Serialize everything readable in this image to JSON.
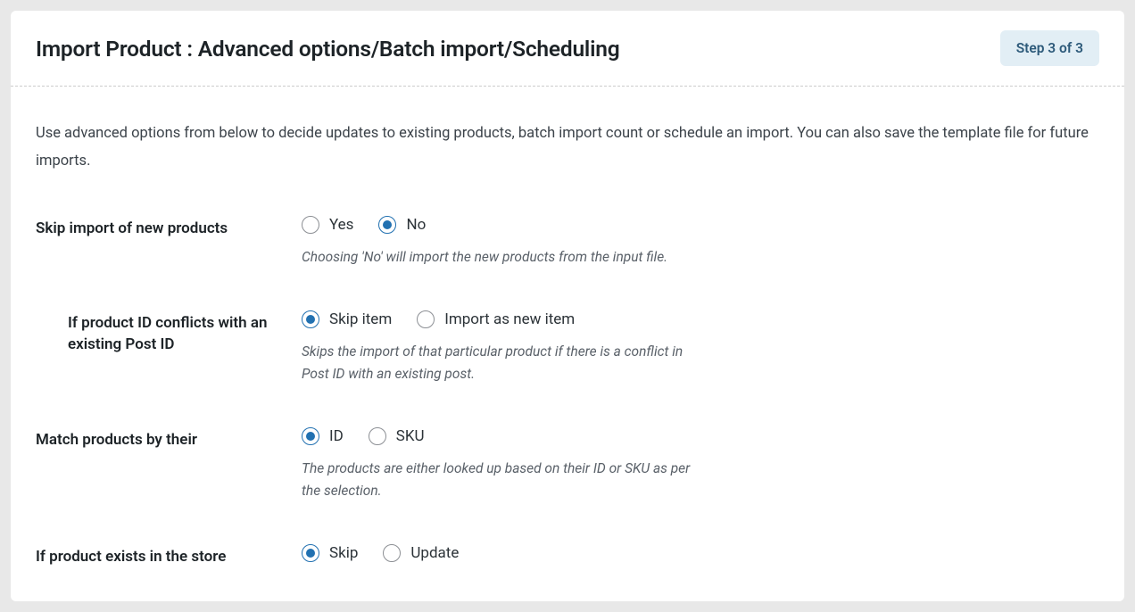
{
  "header": {
    "title": "Import Product : Advanced options/Batch import/Scheduling",
    "step_badge": "Step 3 of 3"
  },
  "intro": "Use advanced options from below to decide updates to existing products, batch import count or schedule an import. You can also save the template file for future imports.",
  "rows": [
    {
      "label": "Skip import of new products",
      "options": [
        {
          "label": "Yes",
          "selected": false
        },
        {
          "label": "No",
          "selected": true
        }
      ],
      "help": "Choosing 'No' will import the new products from the input file."
    },
    {
      "label": "If product ID conflicts with an existing Post ID",
      "options": [
        {
          "label": "Skip item",
          "selected": true
        },
        {
          "label": "Import as new item",
          "selected": false
        }
      ],
      "help": "Skips the import of that particular product if there is a conflict in Post ID with an existing post."
    },
    {
      "label": "Match products by their",
      "options": [
        {
          "label": "ID",
          "selected": true
        },
        {
          "label": "SKU",
          "selected": false
        }
      ],
      "help": "The products are either looked up based on their ID or SKU as per the selection."
    },
    {
      "label": "If product exists in the store",
      "options": [
        {
          "label": "Skip",
          "selected": true
        },
        {
          "label": "Update",
          "selected": false
        }
      ],
      "help": ""
    }
  ]
}
